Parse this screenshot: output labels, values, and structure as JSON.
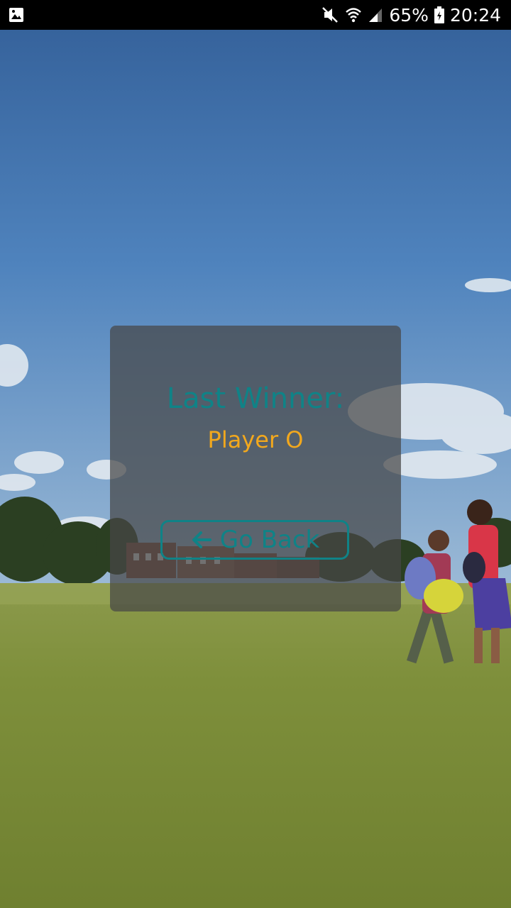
{
  "status_bar": {
    "battery": "65%",
    "time": "20:24",
    "icons": [
      "image-notification-icon",
      "mute-icon",
      "wifi-icon",
      "signal-icon",
      "battery-charging-icon"
    ]
  },
  "dialog": {
    "title": "Last Winner:",
    "winner": "Player O",
    "back_button": {
      "label": "Go Back",
      "icon": "arrow-left-icon"
    }
  },
  "colors": {
    "accent": "#0f8387",
    "winner_text": "#f2a81d",
    "card_overlay": "rgba(70,70,70,0.72)"
  }
}
